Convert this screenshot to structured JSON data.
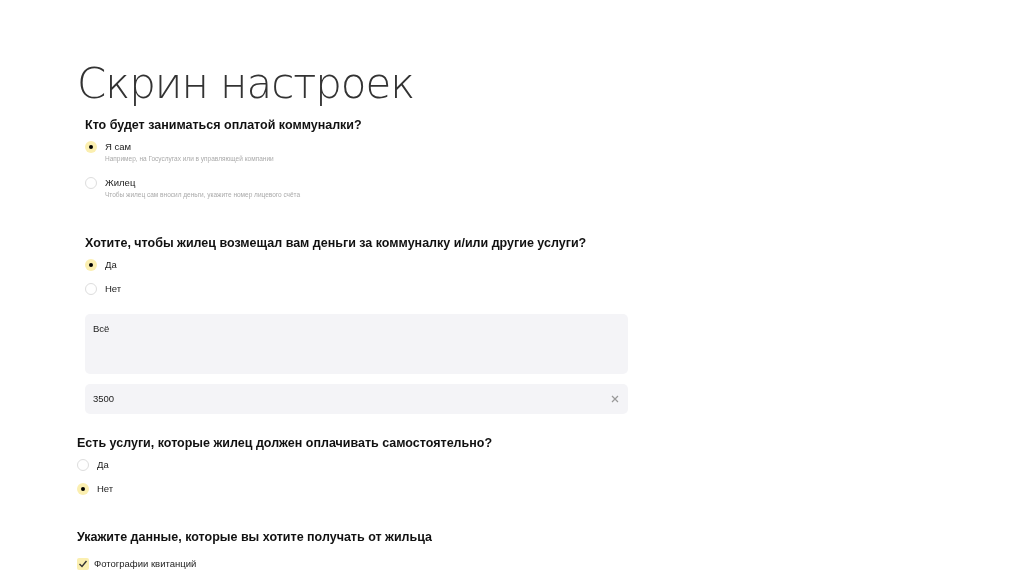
{
  "title": "Скрин настроек",
  "screenshots": [
    {
      "sections": [
        {
          "question": "Кто будет заниматься оплатой коммуналки?",
          "options": [
            {
              "label": "Я сам",
              "hint": "Например, на Госуслугах или в управляющей компании",
              "selected": true
            },
            {
              "label": "Жилец",
              "hint": "Чтобы жилец сам вносил деньги, укажите номер лицевого счёта",
              "selected": false
            }
          ]
        },
        {
          "question": "Хотите, чтобы жилец возмещал вам деньги за коммуналку и/или другие услуги?",
          "options": [
            {
              "label": "Да",
              "selected": true
            },
            {
              "label": "Нет",
              "selected": false
            }
          ],
          "fields": [
            {
              "kind": "textarea",
              "value": "Всё"
            },
            {
              "kind": "input",
              "value": "3500"
            }
          ]
        }
      ]
    },
    {
      "sections": [
        {
          "question": "Есть услуги, которые жилец должен оплачивать самостоятельно?",
          "options": [
            {
              "label": "Да",
              "selected": false
            },
            {
              "label": "Нет",
              "selected": true
            }
          ]
        },
        {
          "question": "Укажите данные, которые вы хотите получать от жильца",
          "checkboxes": [
            {
              "label": "Фотографии квитанций",
              "checked": true
            }
          ]
        }
      ]
    }
  ]
}
